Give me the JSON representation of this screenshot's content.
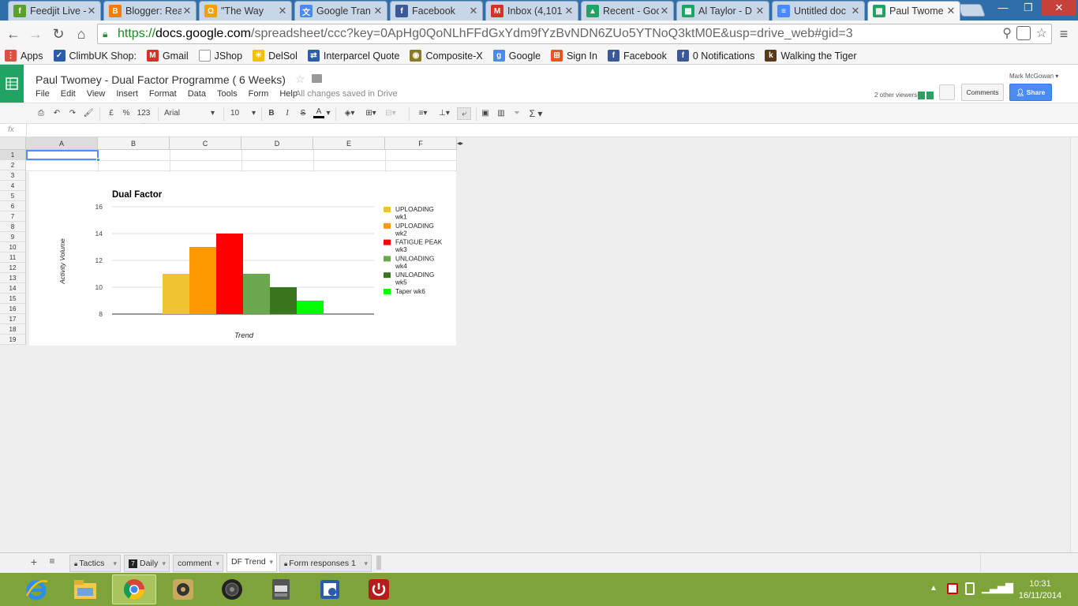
{
  "browser": {
    "tabs": [
      {
        "title": "Feedjit Live -",
        "color": "#5aa02c",
        "glyph": "f"
      },
      {
        "title": "Blogger: Rea",
        "color": "#f57d00",
        "glyph": "B"
      },
      {
        "title": "\"The Way",
        "color": "#f5a000",
        "glyph": "Ω"
      },
      {
        "title": "Google Tran",
        "color": "#4a8af4",
        "glyph": "文"
      },
      {
        "title": "Facebook",
        "color": "#3b5998",
        "glyph": "f"
      },
      {
        "title": "Inbox (4,101",
        "color": "#d93025",
        "glyph": "M"
      },
      {
        "title": "Recent - Goo",
        "color": "#1fa463",
        "glyph": "▲"
      },
      {
        "title": "Al Taylor - D",
        "color": "#1fa463",
        "glyph": "▦"
      },
      {
        "title": "Untitled doc",
        "color": "#4a8af4",
        "glyph": "≡"
      },
      {
        "title": "Paul Twome",
        "color": "#1fa463",
        "glyph": "▦"
      }
    ],
    "url_https": "https://",
    "url_host": "docs.google.com",
    "url_rest": "/spreadsheet/ccc?key=0ApHg0QoNLhFFdGxYdm9fYzBvNDN6ZUo5YTNoQ3ktM0E&usp=drive_web#gid=3",
    "bookmarks": [
      {
        "label": "Apps",
        "color": "#e05040",
        "glyph": "⋮"
      },
      {
        "label": "ClimbUK Shop:",
        "color": "#2a5ca8",
        "glyph": "✓"
      },
      {
        "label": "Gmail",
        "color": "#d93025",
        "glyph": "M"
      },
      {
        "label": "JShop",
        "color": "#ffffff",
        "glyph": " "
      },
      {
        "label": "DelSol",
        "color": "#f2c200",
        "glyph": "☀"
      },
      {
        "label": "Interparcel Quote",
        "color": "#2a5ca8",
        "glyph": "⇄"
      },
      {
        "label": "Composite-X",
        "color": "#8a7a20",
        "glyph": "◉"
      },
      {
        "label": "Google",
        "color": "#4a8af4",
        "glyph": "g"
      },
      {
        "label": "Sign In",
        "color": "#f25022",
        "glyph": "⊞"
      },
      {
        "label": "Facebook",
        "color": "#3b5998",
        "glyph": "f"
      },
      {
        "label": "0 Notifications",
        "color": "#3b5998",
        "glyph": "f"
      },
      {
        "label": "Walking the Tiger",
        "color": "#5a3a1a",
        "glyph": "k"
      }
    ]
  },
  "doc": {
    "title": "Paul Twomey - Dual Factor Programme ( 6 Weeks)",
    "menu": [
      "File",
      "Edit",
      "View",
      "Insert",
      "Format",
      "Data",
      "Tools",
      "Form",
      "Help"
    ],
    "save_status": "All changes saved in Drive",
    "user": "Mark McGowan",
    "viewers": "2 other viewers",
    "comments_label": "Comments",
    "share_label": "Share"
  },
  "format_toolbar": {
    "currency": "£",
    "percent": "%",
    "number_format": "123",
    "font": "Arial",
    "font_size": "10",
    "bold": "B",
    "italic": "I",
    "strike": "S",
    "text_color": "A",
    "sum": "Σ"
  },
  "formula_bar": {
    "label": "fx",
    "value": ""
  },
  "grid": {
    "columns": [
      "A",
      "B",
      "C",
      "D",
      "E",
      "F"
    ],
    "rows": [
      "1",
      "2",
      "3",
      "4",
      "5",
      "6",
      "7",
      "8",
      "9",
      "10",
      "11",
      "12",
      "13",
      "14",
      "15",
      "16",
      "17",
      "18",
      "19"
    ],
    "selected_cell": "A1"
  },
  "chart_data": {
    "type": "bar",
    "title": "Dual Factor",
    "xlabel": "Trend",
    "ylabel": "Activity Volume",
    "ylim": [
      8,
      16
    ],
    "yticks": [
      8,
      10,
      12,
      14,
      16
    ],
    "grid": true,
    "legend_position": "right",
    "series": [
      {
        "name": "UPLOADING wk1",
        "value": 11,
        "color": "#f1c232"
      },
      {
        "name": "UPLOADING wk2",
        "value": 13,
        "color": "#ff9900"
      },
      {
        "name": "FATIGUE PEAK wk3",
        "value": 14,
        "color": "#ff0000"
      },
      {
        "name": "UNLOADING wk4",
        "value": 11,
        "color": "#6aa84f"
      },
      {
        "name": "UNLOADING wk5",
        "value": 10,
        "color": "#38761d"
      },
      {
        "name": "Taper wk6",
        "value": 9,
        "color": "#00ff00"
      }
    ]
  },
  "sheet_tabs": [
    {
      "label": "Tactics",
      "icon": "lock-icon"
    },
    {
      "label": "Daily",
      "icon": "calendar-icon"
    },
    {
      "label": "comment",
      "icon": ""
    },
    {
      "label": "DF Trend",
      "icon": "",
      "active": true
    },
    {
      "label": "Form responses 1",
      "icon": "lock-icon"
    }
  ],
  "taskbar": {
    "time": "10:31",
    "date": "16/11/2014"
  }
}
